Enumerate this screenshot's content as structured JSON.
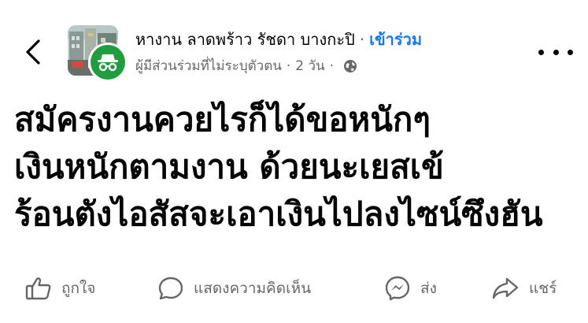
{
  "header": {
    "back_icon": "chevron-left-icon",
    "group_name": "หางาน ลาดพร้าว รัชดา บางกะปิ",
    "separator": "·",
    "join_label": "เข้าร่วม",
    "author": "ผู้มีส่วนร่วมที่ไม่ระบุตัวตน",
    "time": "2 วัน",
    "privacy_icon": "globe-icon",
    "more_icon": "more-horizontal-icon",
    "anon_icon": "incognito-icon",
    "colors": {
      "link": "#1877f2",
      "secondary": "#65676b",
      "anon_badge": "#1f9d3f"
    }
  },
  "post": {
    "lines": [
      "สมัครงานควยไรก็ได้ขอหนักๆ",
      "เงินหนักตามงาน ด้วยนะเยสเข้",
      "ร้อนตังไอสัสจะเอาเงินไปลงไซน์ซึงฮัน"
    ]
  },
  "actions": {
    "like": {
      "label": "ถูกใจ",
      "icon": "like-icon"
    },
    "comment": {
      "label": "แสดงความคิดเห็น",
      "icon": "comment-icon"
    },
    "send": {
      "label": "ส่ง",
      "icon": "messenger-icon"
    },
    "share": {
      "label": "แชร์",
      "icon": "share-icon"
    }
  }
}
